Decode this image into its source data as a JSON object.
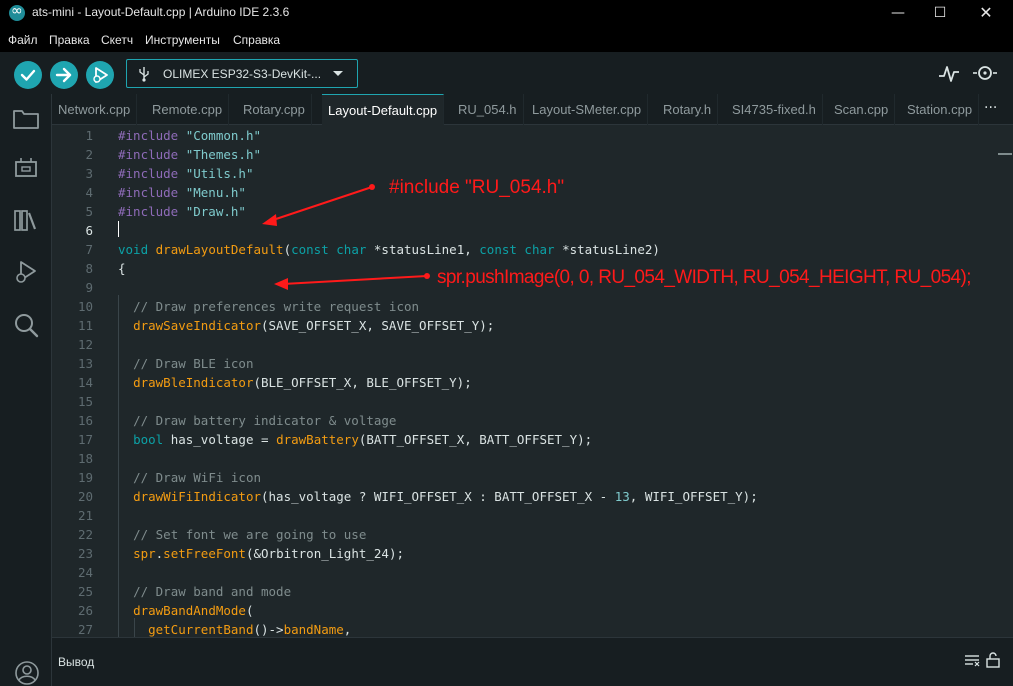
{
  "window": {
    "title": "ats-mini - Layout-Default.cpp | Arduino IDE 2.3.6",
    "minimize": "—",
    "maximize": "☐",
    "close": "✕"
  },
  "menu": {
    "items": [
      "Файл",
      "Правка",
      "Скетч",
      "Инструменты",
      "Справка"
    ]
  },
  "toolbar": {
    "board": "OLIMEX ESP32-S3-DevKit-..."
  },
  "tabs": [
    {
      "label": "Network.cpp"
    },
    {
      "label": "Remote.cpp"
    },
    {
      "label": "Rotary.cpp"
    },
    {
      "label": "Layout-Default.cpp"
    },
    {
      "label": "RU_054.h"
    },
    {
      "label": "Layout-SMeter.cpp"
    },
    {
      "label": "Rotary.h"
    },
    {
      "label": "SI4735-fixed.h"
    },
    {
      "label": "Scan.cpp"
    },
    {
      "label": "Station.cpp"
    }
  ],
  "tabs_more": "···",
  "editor": {
    "line_numbers": [
      "1",
      "2",
      "3",
      "4",
      "5",
      "6",
      "7",
      "8",
      "9",
      "10",
      "11",
      "12",
      "13",
      "14",
      "15",
      "16",
      "17",
      "18",
      "19",
      "20",
      "21",
      "22",
      "23",
      "24",
      "25",
      "26",
      "27"
    ],
    "current_line": 6
  },
  "annotations": {
    "include": "#include \"RU_054.h\"",
    "push": "spr.pushImage(0, 0, RU_054_WIDTH, RU_054_HEIGHT, RU_054);"
  },
  "output": {
    "label": "Вывод"
  },
  "icons": {
    "verify": "check-icon",
    "upload": "arrow-right-icon",
    "debug": "debug-icon",
    "sketchbook": "folder-icon",
    "boards": "boards-icon",
    "library": "library-icon",
    "debugger": "debug-panel-icon",
    "search": "search-icon",
    "account": "account-icon"
  },
  "colors": {
    "accent": "#1fa5b0",
    "annotation": "#ff1a1a",
    "background": "#1f272a"
  }
}
